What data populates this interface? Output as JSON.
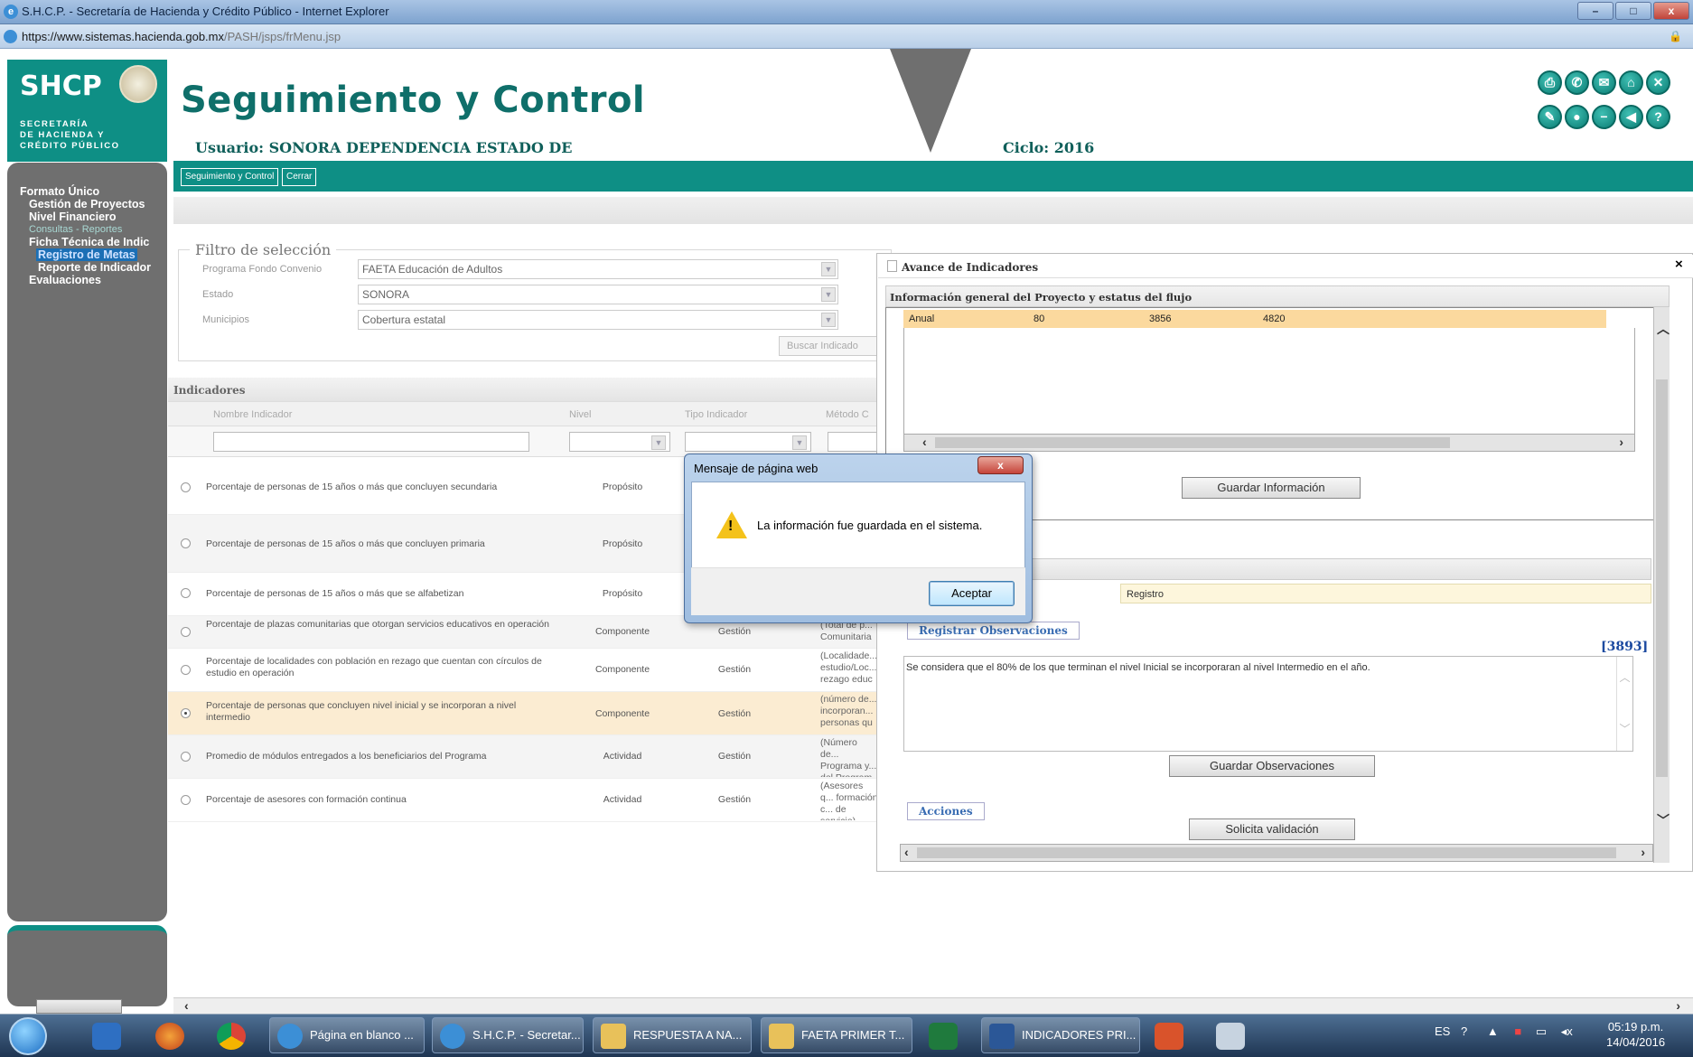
{
  "window": {
    "title": "S.H.C.P. - Secretaría de Hacienda y Crédito Público - Internet Explorer",
    "url_prefix": "https://www.sistemas.",
    "url_domain": "hacienda.gob.mx",
    "url_path": "/PASH/jsps/frMenu.jsp",
    "minimize": "–",
    "maximize": "□",
    "close": "x"
  },
  "header": {
    "logo_text": "SHCP",
    "logo_subtitle_lines": [
      "SECRETARÍA",
      "DE HACIENDA Y",
      "CRÉDITO PÚBLICO"
    ],
    "title": "Seguimiento y Control",
    "usuario": "Usuario: SONORA DEPENDENCIA ESTADO DE",
    "ciclo": "Ciclo: 2016",
    "icons": [
      "print-icon",
      "phone-icon",
      "mail-icon",
      "home-icon",
      "close-icon",
      "edit-icon",
      "eye-icon",
      "minus-icon",
      "back-icon",
      "help-icon"
    ]
  },
  "tabs": [
    "Seguimiento y Control",
    "Cerrar"
  ],
  "sidebar": {
    "items": [
      {
        "label": "Formato Único",
        "kind": "main"
      },
      {
        "label": "Gestión de Proyectos",
        "kind": "main"
      },
      {
        "label": "Nivel Financiero",
        "kind": "main"
      },
      {
        "label": "Consultas - Reportes",
        "kind": "sub"
      },
      {
        "label": "Ficha Técnica de Indic",
        "kind": "main"
      },
      {
        "label": "Registro de Metas",
        "kind": "active"
      },
      {
        "label": "Reporte de Indicador",
        "kind": "main"
      },
      {
        "label": "Evaluaciones",
        "kind": "main"
      }
    ]
  },
  "filtro": {
    "title": "Filtro de selección",
    "programa_label": "Programa Fondo Convenio",
    "programa_value": "FAETA Educación de Adultos",
    "estado_label": "Estado",
    "estado_value": "SONORA",
    "municipios_label": "Municipios",
    "municipios_value": "Cobertura estatal",
    "buscar": "Buscar Indicado"
  },
  "indicadores": {
    "title": "Indicadores",
    "columns": [
      "Nombre Indicador",
      "Nivel",
      "Tipo Indicador",
      "Método C"
    ],
    "rows": [
      {
        "nombre": "Porcentaje de personas de 15 años o más que concluyen secundaria",
        "nivel": "Propósito",
        "tipo": "",
        "metodo": ""
      },
      {
        "nombre": "Porcentaje de personas de 15 años o más que concluyen primaria",
        "nivel": "Propósito",
        "tipo": "",
        "metodo": ""
      },
      {
        "nombre": "Porcentaje de personas de 15 años o más que se alfabetizan",
        "nivel": "Propósito",
        "tipo": "",
        "metodo": ""
      },
      {
        "nombre": "Porcentaje de plazas comunitarias que otorgan servicios educativos en operación",
        "nivel": "Componente",
        "tipo": "Gestión",
        "metodo": "(Total de p... Comunitaria"
      },
      {
        "nombre": "Porcentaje de localidades con población en rezago que cuentan con círculos de estudio en operación",
        "nivel": "Componente",
        "tipo": "Gestión",
        "metodo": "(Localidade... estudio/Loc... rezago educ"
      },
      {
        "nombre": "Porcentaje de personas que concluyen nivel inicial y se incorporan a nivel intermedio",
        "nivel": "Componente",
        "tipo": "Gestión",
        "metodo": "(número de... incorporan... personas qu"
      },
      {
        "nombre": "Promedio de módulos entregados a los beneficiarios del Programa",
        "nivel": "Actividad",
        "tipo": "Gestión",
        "metodo": "(Número de... Programa y... del Program"
      },
      {
        "nombre": "Porcentaje de asesores con formación continua",
        "nivel": "Actividad",
        "tipo": "Gestión",
        "metodo": "(Asesores q... formación c... de servicio)"
      }
    ]
  },
  "avance": {
    "title": "Avance de Indicadores",
    "close": "×",
    "info_title": "Información general del Proyecto y estatus del flujo",
    "anual_row": [
      "Anual",
      "80",
      "3856",
      "4820"
    ],
    "guardar_info": "Guardar Información",
    "registro": "Registro",
    "registrar_obs": "Registrar Observaciones",
    "obs_count": "[3893]",
    "obs_text": "Se considera que el 80% de los que terminan el nivel Inicial se incorporaran al nivel Intermedio en el año.",
    "guardar_obs": "Guardar Observaciones",
    "acciones": "Acciones",
    "solicita": "Solicita validación"
  },
  "modal": {
    "title": "Mensaje de página web",
    "close": "x",
    "message": "La información fue guardada en el sistema.",
    "ok": "Aceptar"
  },
  "taskbar": {
    "items": [
      "Página en blanco ...",
      "S.H.C.P. - Secretar...",
      "RESPUESTA A NA...",
      "FAETA PRIMER T...",
      "INDICADORES PRI..."
    ],
    "lang": "ES",
    "time": "05:19 p.m.",
    "date": "14/04/2016"
  }
}
